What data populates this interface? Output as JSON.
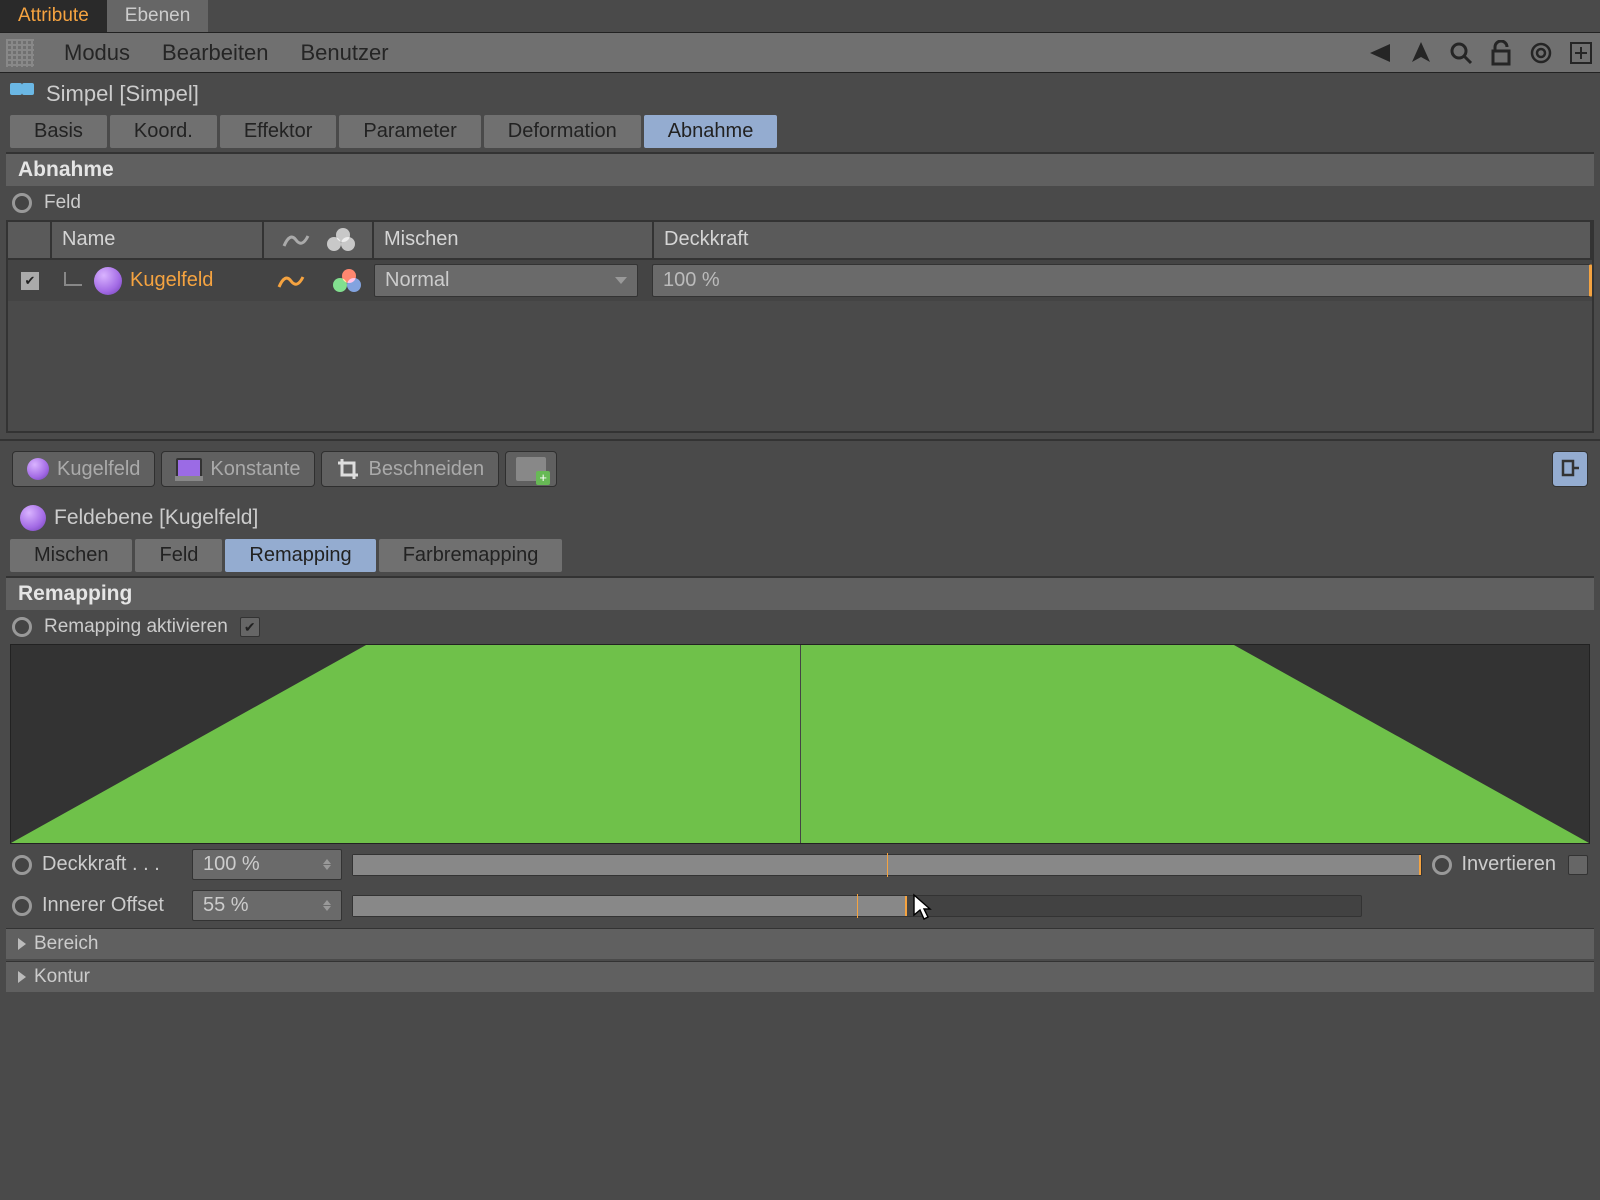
{
  "top_tabs": {
    "attribute": "Attribute",
    "ebenen": "Ebenen"
  },
  "menubar": {
    "modus": "Modus",
    "bearbeiten": "Bearbeiten",
    "benutzer": "Benutzer"
  },
  "title": "Simpel [Simpel]",
  "obj_tabs": {
    "basis": "Basis",
    "koord": "Koord.",
    "effektor": "Effektor",
    "parameter": "Parameter",
    "deformation": "Deformation",
    "abnahme": "Abnahme"
  },
  "section_abnahme": "Abnahme",
  "feld_label": "Feld",
  "table": {
    "headers": {
      "name": "Name",
      "mischen": "Mischen",
      "deckkraft": "Deckkraft"
    },
    "row": {
      "name": "Kugelfeld",
      "blend": "Normal",
      "opacity": "100 %"
    }
  },
  "btns": {
    "kugelfeld": "Kugelfeld",
    "konstante": "Konstante",
    "beschneiden": "Beschneiden"
  },
  "sub_title": "Feldebene [Kugelfeld]",
  "sub_tabs": {
    "mischen": "Mischen",
    "feld": "Feld",
    "remapping": "Remapping",
    "farbremapping": "Farbremapping"
  },
  "section_remap": "Remapping",
  "remap_enable": "Remapping aktivieren",
  "sliders": {
    "deckkraft": {
      "label": "Deckkraft . . .",
      "value": "100 %",
      "fill": 100
    },
    "inner": {
      "label": "Innerer Offset",
      "value": "55 %",
      "fill": 55
    },
    "invert": "Invertieren"
  },
  "collaps": {
    "bereich": "Bereich",
    "kontur": "Kontur"
  }
}
